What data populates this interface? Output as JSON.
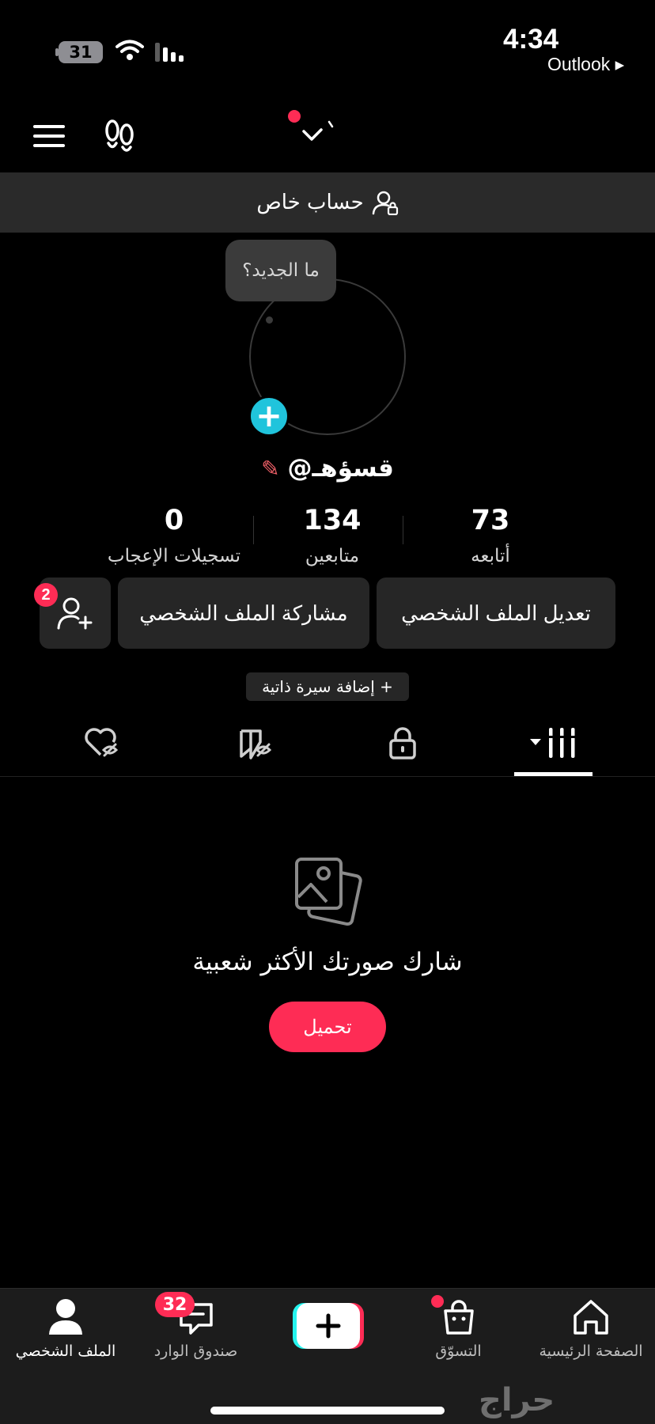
{
  "status_bar": {
    "battery_level": "31",
    "time": "4:34",
    "back_app": "Outlook ▸"
  },
  "icons": {
    "menu": "menu-icon",
    "footprints": "footprint-icon",
    "account_switch": "chevron-down-icon",
    "lock_person": "private-account-icon",
    "add_story": "plus-icon",
    "edit": "pencil-icon",
    "add_friend": "add-friend-icon",
    "photo_placeholder": "photo-stack-icon"
  },
  "banner": {
    "private_account": "حساب خاص"
  },
  "profile": {
    "story_bubble": "ما الجديد؟",
    "username": "@قسؤهـ",
    "stats": [
      {
        "value": "73",
        "label": "أتابعه"
      },
      {
        "value": "134",
        "label": "متابعين"
      },
      {
        "value": "0",
        "label": "تسجيلات الإعجاب"
      }
    ]
  },
  "actions": {
    "edit_profile": "تعديل الملف الشخصي",
    "share_profile": "مشاركة الملف الشخصي",
    "add_friend_badge": "2",
    "add_bio": "+ إضافة سيرة ذاتية"
  },
  "tabs": [
    {
      "name": "videos-grid",
      "icon": "grid-icon",
      "active": true
    },
    {
      "name": "private",
      "icon": "lock-icon",
      "active": false
    },
    {
      "name": "reposts",
      "icon": "repost-hidden-icon",
      "active": false
    },
    {
      "name": "liked",
      "icon": "liked-hidden-icon",
      "active": false
    }
  ],
  "empty_state": {
    "title": "شارك صورتك الأكثر شعبية",
    "upload_button": "تحميل"
  },
  "bottom_nav": {
    "home": "الصفحة الرئيسية",
    "shop": "التسوّق",
    "inbox": "صندوق الوارد",
    "inbox_badge": "32",
    "profile": "الملف الشخصي"
  },
  "watermark": "حراج",
  "colors": {
    "accent": "#fe2c55",
    "story_add": "#20c4dc",
    "surface": "#262626",
    "banner": "#2a2a2a"
  }
}
